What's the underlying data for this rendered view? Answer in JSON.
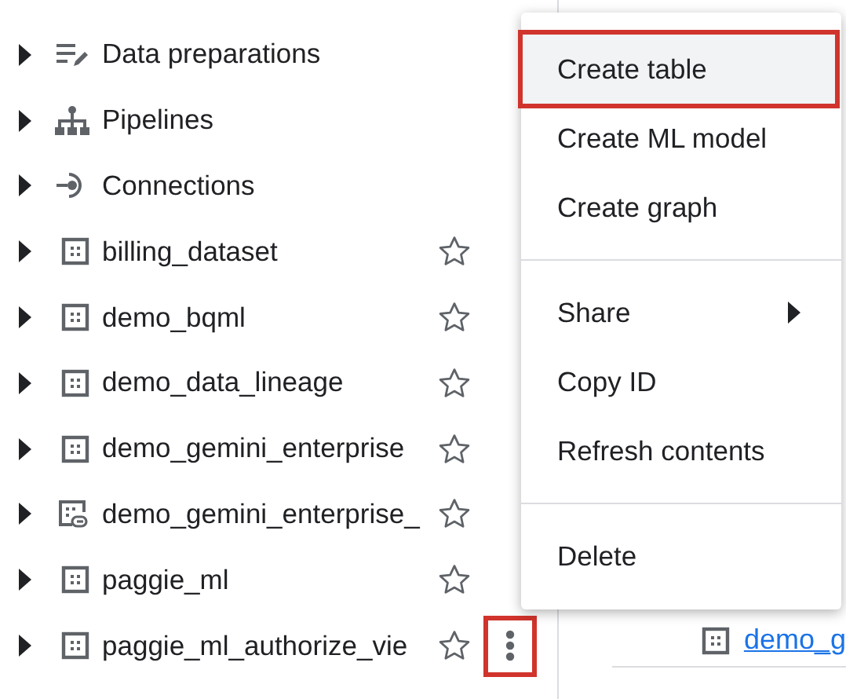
{
  "tree": {
    "items": [
      {
        "label": "Data preparations",
        "kind": "preparations"
      },
      {
        "label": "Pipelines",
        "kind": "pipelines"
      },
      {
        "label": "Connections",
        "kind": "connections"
      },
      {
        "label": "billing_dataset",
        "kind": "dataset",
        "starred": false
      },
      {
        "label": "demo_bqml",
        "kind": "dataset",
        "starred": false
      },
      {
        "label": "demo_data_lineage",
        "kind": "dataset",
        "starred": false
      },
      {
        "label": "demo_gemini_enterprise",
        "kind": "dataset",
        "starred": false
      },
      {
        "label": "demo_gemini_enterprise_",
        "kind": "linked-dataset",
        "starred": false
      },
      {
        "label": "paggie_ml",
        "kind": "dataset",
        "starred": false
      },
      {
        "label": "paggie_ml_authorize_vie",
        "kind": "dataset",
        "starred": false
      }
    ]
  },
  "more_button": {
    "highlighted": true
  },
  "context_menu": {
    "groups": [
      [
        {
          "label": "Create table",
          "selected": true,
          "submenu": false
        },
        {
          "label": "Create ML model",
          "selected": false,
          "submenu": false
        },
        {
          "label": "Create graph",
          "selected": false,
          "submenu": false
        }
      ],
      [
        {
          "label": "Share",
          "selected": false,
          "submenu": true
        },
        {
          "label": "Copy ID",
          "selected": false,
          "submenu": false
        },
        {
          "label": "Refresh contents",
          "selected": false,
          "submenu": false
        }
      ],
      [
        {
          "label": "Delete",
          "selected": false,
          "submenu": false
        }
      ]
    ]
  },
  "detail": {
    "link": "demo_g"
  }
}
